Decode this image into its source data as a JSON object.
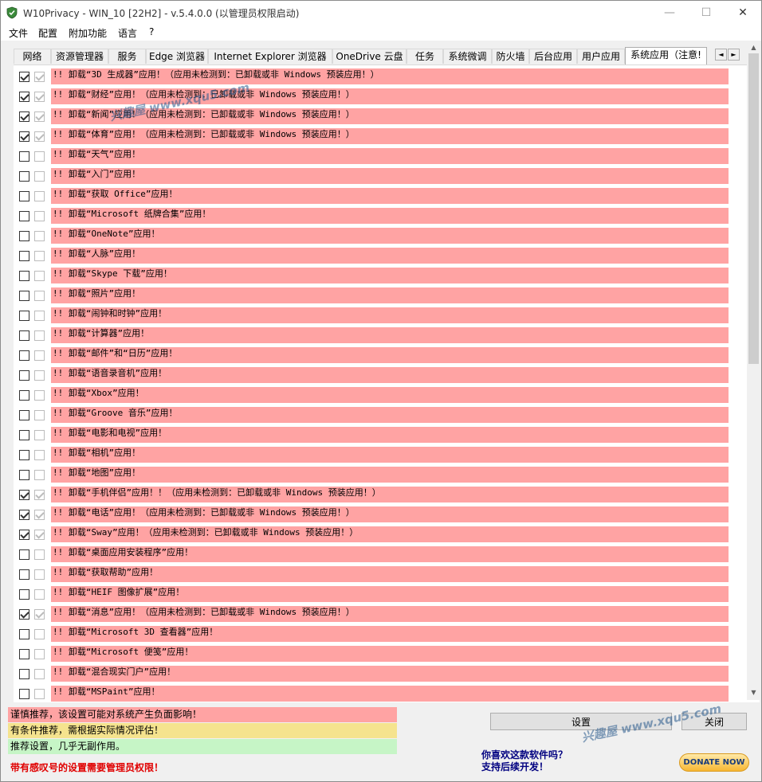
{
  "window": {
    "title": "W10Privacy - WIN_10 [22H2]   - v.5.4.0.0 (以管理员权限启动)",
    "controls": {
      "minimize": "—",
      "maximize": "☐",
      "close": "✕"
    }
  },
  "menu": [
    "文件",
    "配置",
    "附加功能",
    "语言",
    "?"
  ],
  "tabs": [
    "网络",
    "资源管理器",
    "服务",
    "Edge 浏览器",
    "Internet Explorer 浏览器",
    "OneDrive 云盘",
    "任务",
    "系统微调",
    "防火墙",
    "后台应用",
    "用户应用",
    "系统应用（注意!"
  ],
  "active_tab_index": 11,
  "tab_scroll": {
    "left": "◄",
    "right": "►"
  },
  "rows": [
    {
      "label": "!! 卸载“3D 生成器”应用！（应用未检测到：已卸载或非 Windows 预装应用！）",
      "checked": true
    },
    {
      "label": "!! 卸载“财经”应用！（应用未检测到：已卸载或非 Windows 预装应用！）",
      "checked": true
    },
    {
      "label": "!! 卸载“新闻”应用！（应用未检测到：已卸载或非 Windows 预装应用！）",
      "checked": true
    },
    {
      "label": "!! 卸载“体育”应用！（应用未检测到：已卸载或非 Windows 预装应用！）",
      "checked": true
    },
    {
      "label": "!! 卸载“天气”应用！",
      "checked": false
    },
    {
      "label": "!! 卸载“入门”应用！",
      "checked": false
    },
    {
      "label": "!! 卸载“获取 Office”应用！",
      "checked": false
    },
    {
      "label": "!! 卸载“Microsoft 纸牌合集”应用！",
      "checked": false
    },
    {
      "label": "!! 卸载“OneNote”应用！",
      "checked": false
    },
    {
      "label": "!! 卸载“人脉”应用！",
      "checked": false
    },
    {
      "label": "!! 卸载“Skype 下载”应用！",
      "checked": false
    },
    {
      "label": "!! 卸载“照片”应用！",
      "checked": false
    },
    {
      "label": "!! 卸载“闹钟和时钟”应用！",
      "checked": false
    },
    {
      "label": "!! 卸载“计算器”应用！",
      "checked": false
    },
    {
      "label": "!! 卸载“邮件”和“日历”应用！",
      "checked": false
    },
    {
      "label": "!! 卸载“语音录音机”应用！",
      "checked": false
    },
    {
      "label": "!! 卸载“Xbox”应用！",
      "checked": false
    },
    {
      "label": "!! 卸载“Groove 音乐”应用！",
      "checked": false
    },
    {
      "label": "!! 卸载“电影和电视”应用！",
      "checked": false
    },
    {
      "label": "!! 卸载“相机”应用！",
      "checked": false
    },
    {
      "label": "!! 卸载“地图”应用！",
      "checked": false
    },
    {
      "label": "!! 卸载“手机伴侣”应用！！（应用未检测到：已卸载或非 Windows 预装应用！）",
      "checked": true
    },
    {
      "label": "!! 卸载“电话”应用！（应用未检测到：已卸载或非 Windows 预装应用！）",
      "checked": true
    },
    {
      "label": "!! 卸载“Sway”应用！（应用未检测到：已卸载或非 Windows 预装应用！）",
      "checked": true
    },
    {
      "label": "!! 卸载“桌面应用安装程序”应用！",
      "checked": false
    },
    {
      "label": "!! 卸载“获取帮助”应用！",
      "checked": false
    },
    {
      "label": "!! 卸载“HEIF 图像扩展”应用！",
      "checked": false
    },
    {
      "label": "!! 卸载“消息”应用！（应用未检测到：已卸载或非 Windows 预装应用！）",
      "checked": true
    },
    {
      "label": "!! 卸载“Microsoft 3D 查看器”应用！",
      "checked": false
    },
    {
      "label": "!! 卸载“Microsoft 便笺”应用！",
      "checked": false
    },
    {
      "label": "!! 卸载“混合现实门户”应用！",
      "checked": false
    },
    {
      "label": "!! 卸载“MSPaint”应用！",
      "checked": false
    }
  ],
  "legend": {
    "red": "谨慎推荐，该设置可能对系统产生负面影响！",
    "yellow": "有条件推荐，需根据实际情况评估！",
    "green": "推荐设置，几乎无副作用。"
  },
  "admin_note": "带有感叹号的设置需要管理员权限！",
  "buttons": {
    "set": "设置",
    "close": "关闭",
    "donate": "DONATE NOW"
  },
  "promo": {
    "line1": "你喜欢这款软件吗？",
    "line2": "支持后续开发！"
  },
  "watermark": "兴趣屋 www.xqu5.com",
  "colors": {
    "red": "#ffa3a3",
    "yellow": "#f5e38e",
    "green": "#c6f5c6",
    "warning_text": "#e00000",
    "promo_text": "#000080"
  }
}
